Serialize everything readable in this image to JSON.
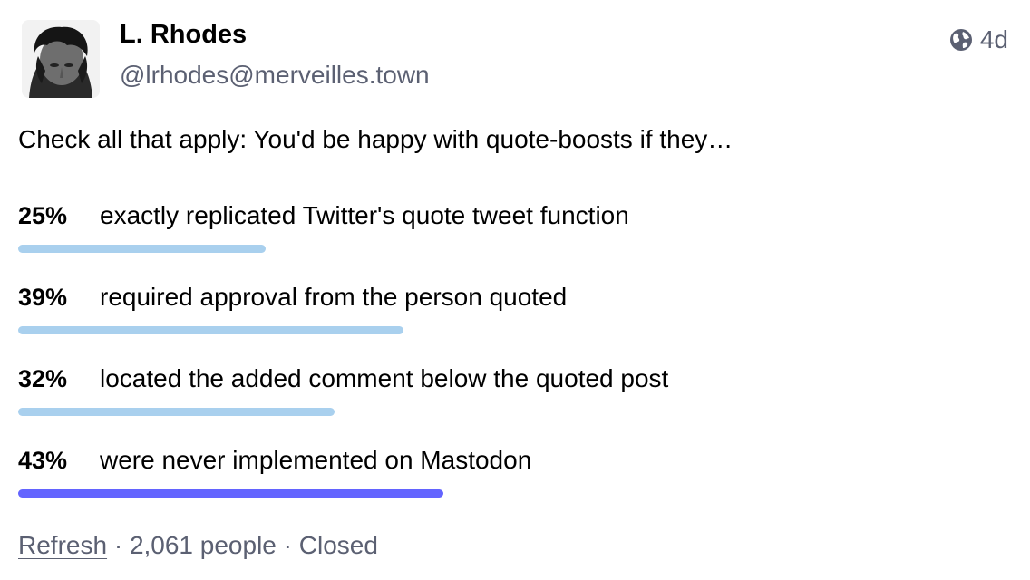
{
  "author": {
    "display_name": "L. Rhodes",
    "handle": "@lrhodes@merveilles.town",
    "avatar_icon": "user-avatar"
  },
  "meta": {
    "visibility_icon": "globe-icon",
    "age": "4d"
  },
  "status": {
    "text": "Check all that apply: You'd be happy with quote-boosts if they…"
  },
  "poll": {
    "options": [
      {
        "percent": "25%",
        "value": 25,
        "label": "exactly replicated Twitter's quote tweet function",
        "leading": false
      },
      {
        "percent": "39%",
        "value": 39,
        "label": "required approval from the person quoted",
        "leading": false
      },
      {
        "percent": "32%",
        "value": 32,
        "label": "located the added comment below the quoted post",
        "leading": false
      },
      {
        "percent": "43%",
        "value": 43,
        "label": "were never implemented on Mastodon",
        "leading": true
      }
    ],
    "refresh_label": "Refresh",
    "separator": " · ",
    "voters": "2,061 people",
    "state": "Closed"
  },
  "colors": {
    "bar": "#a9d0ee",
    "bar_leading": "#6364ff",
    "muted_text": "#5b6072"
  }
}
